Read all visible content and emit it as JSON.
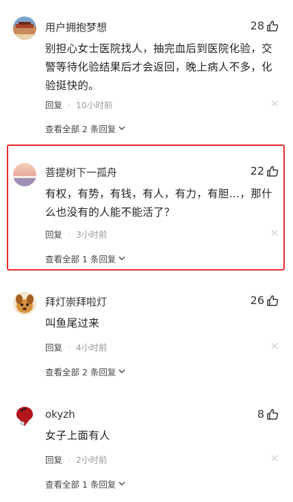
{
  "comments": [
    {
      "username": "用户拥抱梦想",
      "likes": "28",
      "lines": [
        "别担心女士医院找人，抽完血后到医院化验，交",
        "警等待化验结果后才会返回，晚上病人不多，化",
        "验挺快的。"
      ],
      "reply_label": "回复",
      "separator": "·",
      "time": "10小时前",
      "view_replies": "查看全部 2 条回复",
      "avatar_icon": "landscape-avatar-icon"
    },
    {
      "username": "菩提树下一孤舟",
      "likes": "22",
      "lines": [
        "有权，有势，有钱，有人，有力，有胆…，那什",
        "么也没有的人能不能活了？"
      ],
      "reply_label": "回复",
      "separator": "·",
      "time": "3小时前",
      "view_replies": "查看全部 1 条回复",
      "avatar_icon": "sunset-avatar-icon"
    },
    {
      "username": "拜灯崇拜啦灯",
      "likes": "26",
      "lines": [
        "叫鱼尾过来"
      ],
      "reply_label": "回复",
      "separator": "·",
      "time": "4小时前",
      "view_replies": "查看全部 2 条回复",
      "avatar_icon": "cartoon-dog-avatar-icon"
    },
    {
      "username": "okyzh",
      "likes": "8",
      "lines": [
        "女子上面有人"
      ],
      "reply_label": "回复",
      "separator": "·",
      "time": "2小时前",
      "view_replies": "查看全部 1 条回复",
      "avatar_icon": "red-lamp-avatar-icon"
    }
  ],
  "colors": {
    "highlight_border": "#e8262a",
    "meta_time": "#999999",
    "text": "#222222"
  }
}
